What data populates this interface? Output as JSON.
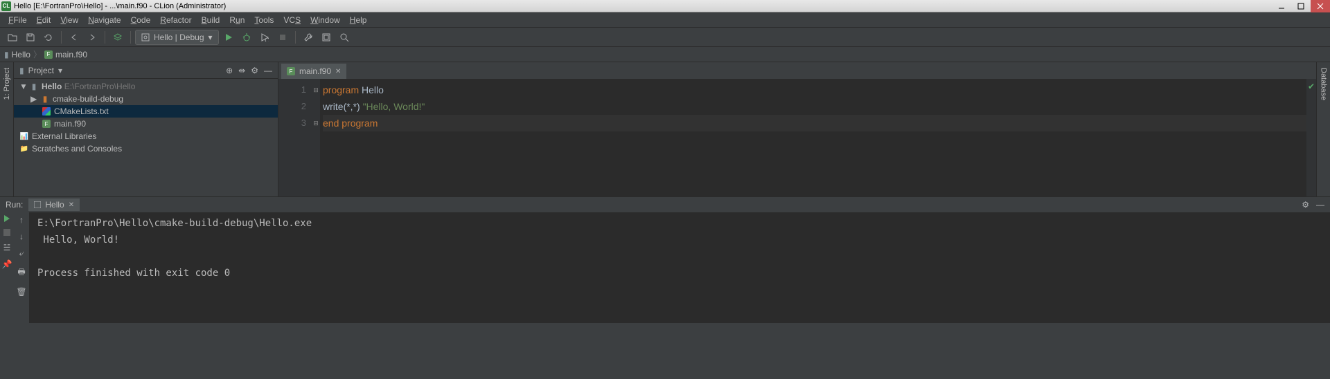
{
  "window": {
    "title": "Hello [E:\\FortranPro\\Hello] - ...\\main.f90 - CLion (Administrator)"
  },
  "menu": [
    "File",
    "Edit",
    "View",
    "Navigate",
    "Code",
    "Refactor",
    "Build",
    "Run",
    "Tools",
    "VCS",
    "Window",
    "Help"
  ],
  "runConfig": "Hello | Debug",
  "breadcrumb": {
    "project": "Hello",
    "file": "main.f90"
  },
  "projectPanel": {
    "title": "Project",
    "root": {
      "name": "Hello",
      "path": "E:\\FortranPro\\Hello"
    },
    "children": [
      {
        "name": "cmake-build-debug",
        "type": "folder"
      },
      {
        "name": "CMakeLists.txt",
        "type": "cmake",
        "selected": true
      },
      {
        "name": "main.f90",
        "type": "fortran"
      }
    ],
    "extras": [
      "External Libraries",
      "Scratches and Consoles"
    ]
  },
  "editor": {
    "tab": "main.f90",
    "lines": [
      {
        "n": 1,
        "tokens": [
          [
            "kw",
            "program"
          ],
          [
            "sp",
            " "
          ],
          [
            "ident",
            "Hello"
          ]
        ]
      },
      {
        "n": 2,
        "tokens": [
          [
            "ident",
            "write"
          ],
          [
            "sym",
            "(*,*) "
          ],
          [
            "str",
            "\"Hello, World!\""
          ]
        ]
      },
      {
        "n": 3,
        "tokens": [
          [
            "kw",
            "end program"
          ]
        ],
        "current": true
      }
    ]
  },
  "run": {
    "label": "Run:",
    "tab": "Hello",
    "output": "E:\\FortranPro\\Hello\\cmake-build-debug\\Hello.exe\n Hello, World!\n\nProcess finished with exit code 0"
  },
  "sideTabs": {
    "left": "1: Project",
    "right": "Database"
  }
}
